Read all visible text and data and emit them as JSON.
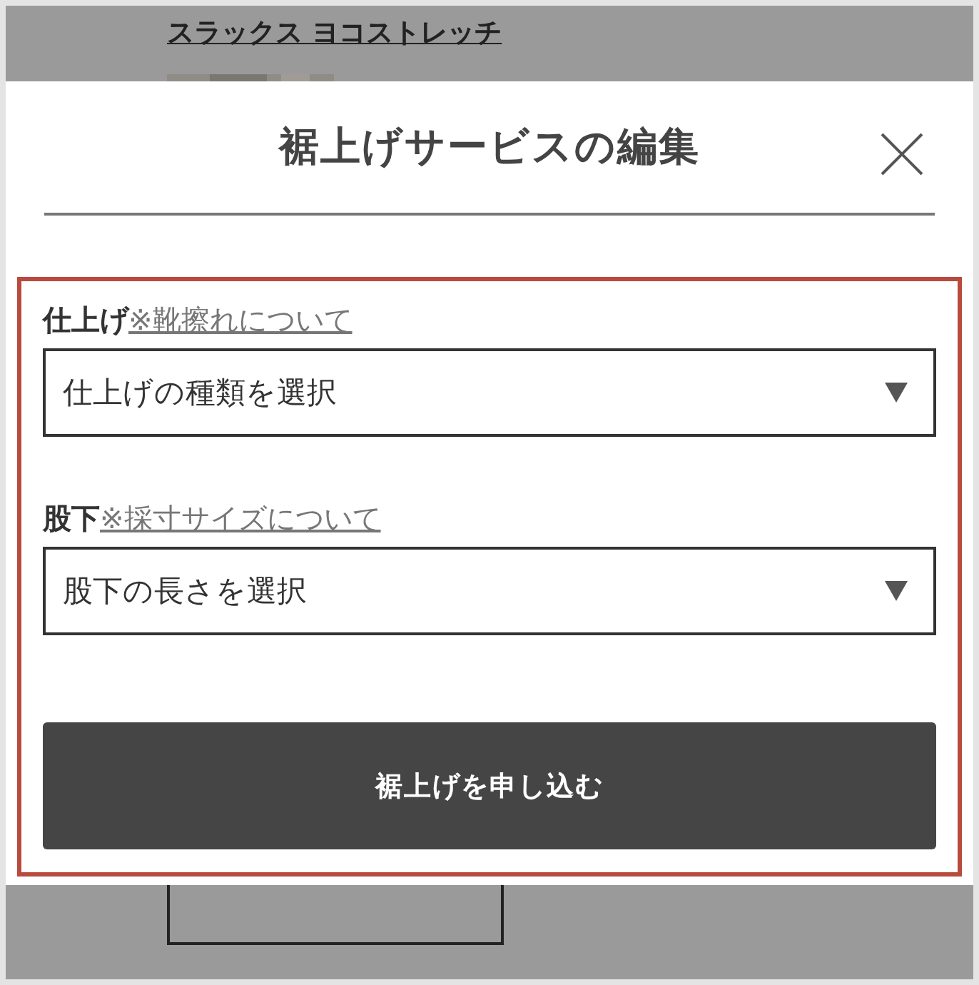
{
  "background_page": {
    "product_title": "スラックス ヨコストレッチ"
  },
  "modal": {
    "title": "裾上げサービスの編集",
    "highlighted": true,
    "fields": [
      {
        "label": "仕上げ",
        "link": "※靴擦れについて",
        "placeholder": "仕上げの種類を選択"
      },
      {
        "label": "股下",
        "link": "※採寸サイズについて",
        "placeholder": "股下の長さを選択"
      }
    ],
    "submit_button": "裾上げを申し込む"
  }
}
